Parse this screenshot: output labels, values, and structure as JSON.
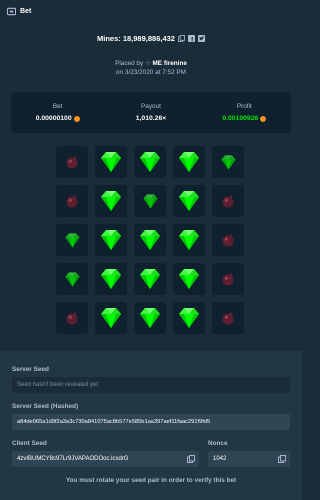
{
  "header": {
    "title": "Bet",
    "icon": "ticket-icon"
  },
  "bet_info": {
    "mines_label": "Mines: 18,989,886,432",
    "placed_by_prefix": "Placed by",
    "player_name": "ME firenine",
    "date_line": "on 3/23/2020 at 7:52 PM"
  },
  "stats": {
    "bet_label": "Bet",
    "bet_value": "0.00000100",
    "payout_label": "Payout",
    "payout_value": "1,010.26×",
    "profit_label": "Profit",
    "profit_value": "0.00100926",
    "currency_icon": "bitcoin-icon",
    "profit_color": "#00e701"
  },
  "board": [
    [
      "mine-dim",
      "gem",
      "gem",
      "gem",
      "gem-dim"
    ],
    [
      "mine-dim",
      "gem",
      "gem-dim",
      "gem",
      "mine-dim"
    ],
    [
      "gem-dim",
      "gem",
      "gem",
      "gem",
      "mine-dim"
    ],
    [
      "gem-dim",
      "gem",
      "gem",
      "gem",
      "mine-dim"
    ],
    [
      "mine-dim",
      "gem",
      "gem",
      "gem",
      "mine-dim"
    ]
  ],
  "seeds": {
    "server_seed_label": "Server Seed",
    "server_seed_value": "Seed hasn't been revealed yet",
    "server_hashed_label": "Server Seed (Hashed)",
    "server_hashed_value": "a84de065a1d9f2a3a3c730a841075ac8b577e585b1aa397aef11faac291f9fd5",
    "client_seed_label": "Client Seed",
    "client_seed_value": "4zvIBUMCY8c97Lr9JVAPAODOoc.lcsdrG",
    "nonce_label": "Nonce",
    "nonce_value": "1042",
    "rotate_notice": "You must rotate your seed pair in order to verify this bet"
  }
}
